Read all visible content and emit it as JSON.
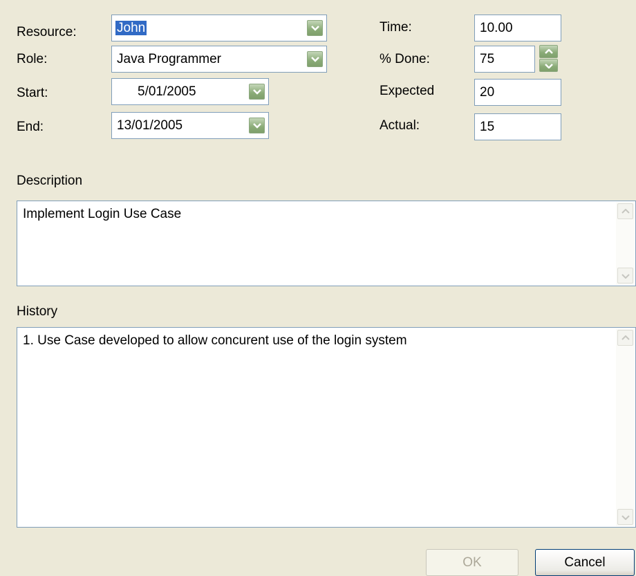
{
  "form": {
    "resource": {
      "label": "Resource:",
      "value": "John"
    },
    "role": {
      "label": "Role:",
      "value": "Java Programmer"
    },
    "start": {
      "label": "Start:",
      "value": "5/01/2005"
    },
    "end": {
      "label": "End:",
      "value": "13/01/2005"
    },
    "time": {
      "label": "Time:",
      "value": "10.00"
    },
    "percent_done": {
      "label": "% Done:",
      "value": "75"
    },
    "expected": {
      "label": "Expected",
      "value": "20"
    },
    "actual": {
      "label": "Actual:",
      "value": "15"
    }
  },
  "description": {
    "label": "Description",
    "value": "Implement Login Use Case"
  },
  "history": {
    "label": "History",
    "value": "1. Use Case developed to allow concurent use of the login system"
  },
  "buttons": {
    "ok": "OK",
    "cancel": "Cancel"
  },
  "colors": {
    "background": "#ece9d8",
    "field_border": "#7f9db9",
    "dropdown_button": "#8aab77",
    "selection": "#316ac5"
  }
}
